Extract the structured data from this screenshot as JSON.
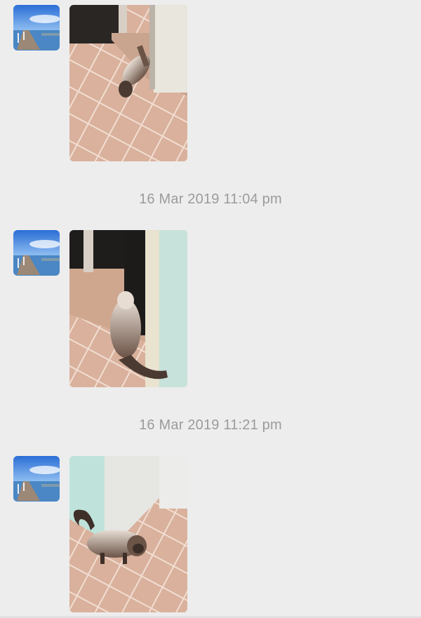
{
  "chat": {
    "timestamps": [
      "16 Mar 2019 11:04 pm",
      "16 Mar 2019 11:21 pm"
    ],
    "messages": [
      {
        "sender_avatar": "avatar-pier-photo",
        "content": "photo-cat-on-tiles"
      },
      {
        "sender_avatar": "avatar-pier-photo",
        "content": "photo-cat-by-door"
      },
      {
        "sender_avatar": "avatar-pier-photo",
        "content": "photo-cat-in-corner"
      }
    ]
  },
  "colors": {
    "background": "#ededed",
    "timestamp_text": "#9b9b9b",
    "tile": "#d9b19c",
    "grout": "#f1ded2"
  }
}
